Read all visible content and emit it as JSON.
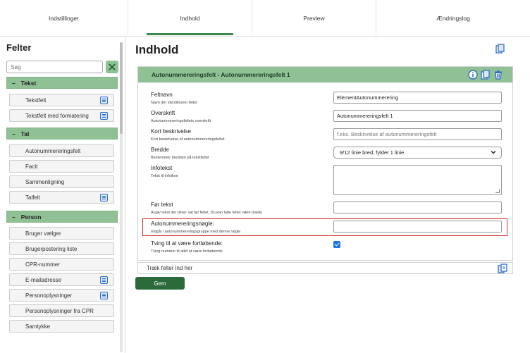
{
  "tabs": [
    {
      "label": "Indstillinger",
      "active": false
    },
    {
      "label": "Indhold",
      "active": true
    },
    {
      "label": "Preview",
      "active": false
    },
    {
      "label": "Ændringslog",
      "active": false
    }
  ],
  "sidebar": {
    "title": "Felter",
    "search_placeholder": "Søg",
    "clear_icon": "clear-filter-icon",
    "sections": [
      {
        "label": "Tekst",
        "items": [
          {
            "label": "Tekstfelt",
            "doc_icon": true
          },
          {
            "label": "Tekstfelt med formatering",
            "doc_icon": true
          }
        ]
      },
      {
        "label": "Tal",
        "items": [
          {
            "label": "Autonummereringsfelt",
            "doc_icon": false
          },
          {
            "label": "Facit",
            "doc_icon": false
          },
          {
            "label": "Sammenligning",
            "doc_icon": false
          },
          {
            "label": "Talfelt",
            "doc_icon": true
          }
        ]
      },
      {
        "label": "Person",
        "items": [
          {
            "label": "Bruger vælger",
            "doc_icon": false
          },
          {
            "label": "Brugerpostering liste",
            "doc_icon": false
          },
          {
            "label": "CPR-nummer",
            "doc_icon": false
          },
          {
            "label": "E-mailadresse",
            "doc_icon": true
          },
          {
            "label": "Personoplysninger",
            "doc_icon": true
          },
          {
            "label": "Personoplysninger fra CPR",
            "doc_icon": false
          },
          {
            "label": "Samtykke",
            "doc_icon": false
          }
        ]
      }
    ]
  },
  "main": {
    "title": "Indhold",
    "panel": {
      "title": "Autonummereringsfelt - Autonummereringsfelt 1",
      "fields": [
        {
          "label": "Feltnavn",
          "help": "Navn der identificerer feltet",
          "type": "input",
          "value": "ElementAutonummerering",
          "placeholder": ""
        },
        {
          "label": "Overskrift",
          "help": "Autonummereringsfeltets overskrift",
          "type": "input",
          "value": "Autonummereringsfelt 1",
          "placeholder": ""
        },
        {
          "label": "Kort beskrivelse",
          "help": "Kort beskrivelse af autonummereringsfeltet",
          "type": "input",
          "value": "",
          "placeholder": "f.eks. Beskrivelse af autonummereringsfelt"
        },
        {
          "label": "Bredde",
          "help": "Bestemmer bredden på tekstfeltet",
          "type": "select",
          "value": "9/12 linie bred, fylder 1 linie"
        },
        {
          "label": "Infotekst",
          "help": "Tekst til infoikon",
          "type": "textarea",
          "value": ""
        },
        {
          "label": "Før tekst",
          "help": "Angiv tekst der bliver sat før feltet. Du kan lade feltet være blankt",
          "type": "input",
          "value": "",
          "placeholder": ""
        },
        {
          "label": "Autonummereringsnøgle:",
          "help": "Indgår i autonummereringsgruppe med denne nøgle",
          "type": "input",
          "value": "",
          "placeholder": ""
        },
        {
          "label": "Tving til at være fortløbende:",
          "help": "Tving nummer til altid at være fortløbende",
          "type": "checkbox",
          "checked": true
        }
      ]
    },
    "dropzone_label": "Træk felter ind her",
    "save_label": "Gem"
  }
}
